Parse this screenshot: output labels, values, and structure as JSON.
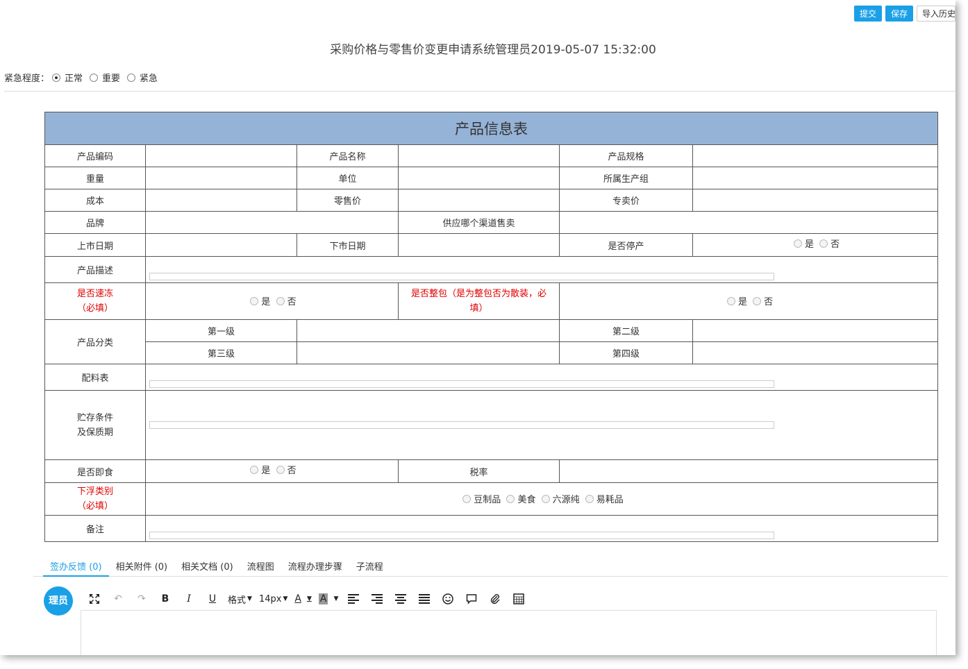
{
  "topbar": {
    "submit_label": "提交",
    "save_label": "保存",
    "import_label": "导入历史"
  },
  "title": "采购价格与零售价变更申请系统管理员2019-05-07 15:32:00",
  "urgency": {
    "label": "紧急程度：",
    "options": [
      "正常",
      "重要",
      "紧急"
    ],
    "selected": "正常"
  },
  "table": {
    "header": "产品信息表",
    "product_code": "产品编码",
    "product_name": "产品名称",
    "product_spec": "产品规格",
    "weight": "重量",
    "unit": "单位",
    "production_group": "所属生产组",
    "cost": "成本",
    "retail_price": "零售价",
    "exclusive_price": "专卖价",
    "brand": "品牌",
    "supply_channel": "供应哪个渠道售卖",
    "launch_date": "上市日期",
    "delist_date": "下市日期",
    "discontinued": "是否停产",
    "description": "产品描述",
    "quick_frozen": "是否速冻",
    "quick_frozen_req": "（必填）",
    "whole_pack": "是否整包（是为整包否为散装，必",
    "whole_pack_req": "填）",
    "category": "产品分类",
    "level1": "第一级",
    "level2": "第二级",
    "level3": "第三级",
    "level4": "第四级",
    "ingredients": "配料表",
    "storage_line1": "贮存条件",
    "storage_line2": "及保质期",
    "ready_to_eat": "是否即食",
    "tax_rate": "税率",
    "float_category": "下浮类别",
    "float_category_req": "（必填）",
    "float_options": [
      "豆制品",
      "美食",
      "六源纯",
      "易耗品"
    ],
    "remarks": "备注",
    "yes": "是",
    "no": "否"
  },
  "tabs": [
    "签办反馈 (0)",
    "相关附件 (0)",
    "相关文档 (0)",
    "流程图",
    "流程办理步骤",
    "子流程"
  ],
  "avatar_text": "理员",
  "toolbar": {
    "format_label": "格式",
    "size_label": "14px"
  },
  "colors": {
    "accent": "#1aa0e6",
    "table_header": "#95b3d7",
    "required": "#e00000"
  }
}
